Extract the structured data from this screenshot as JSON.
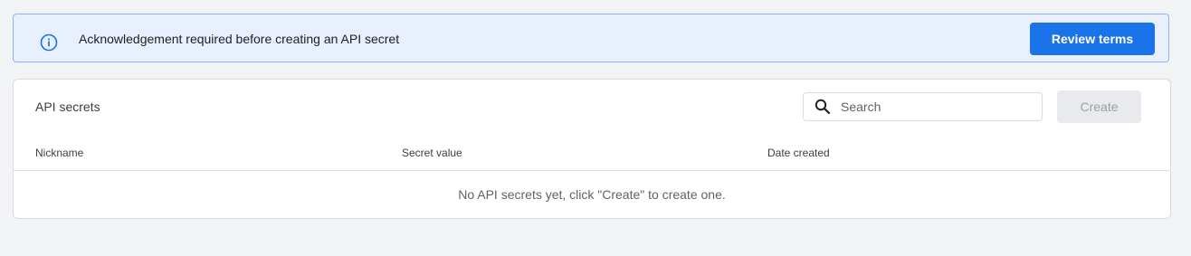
{
  "banner": {
    "message": "Acknowledgement required before creating an API secret",
    "button_label": "Review terms",
    "icon": "info-icon"
  },
  "secrets_card": {
    "title": "API secrets",
    "search": {
      "placeholder": "Search",
      "value": "",
      "icon": "search-icon"
    },
    "create_label": "Create",
    "columns": [
      "Nickname",
      "Secret value",
      "Date created"
    ],
    "empty_message": "No API secrets yet, click \"Create\" to create one."
  },
  "colors": {
    "accent": "#1a73e8",
    "banner_bg": "#e8f0fe",
    "banner_border": "#8ab4f8",
    "disabled_bg": "#e8eaed",
    "page_bg": "#f1f3f4"
  }
}
